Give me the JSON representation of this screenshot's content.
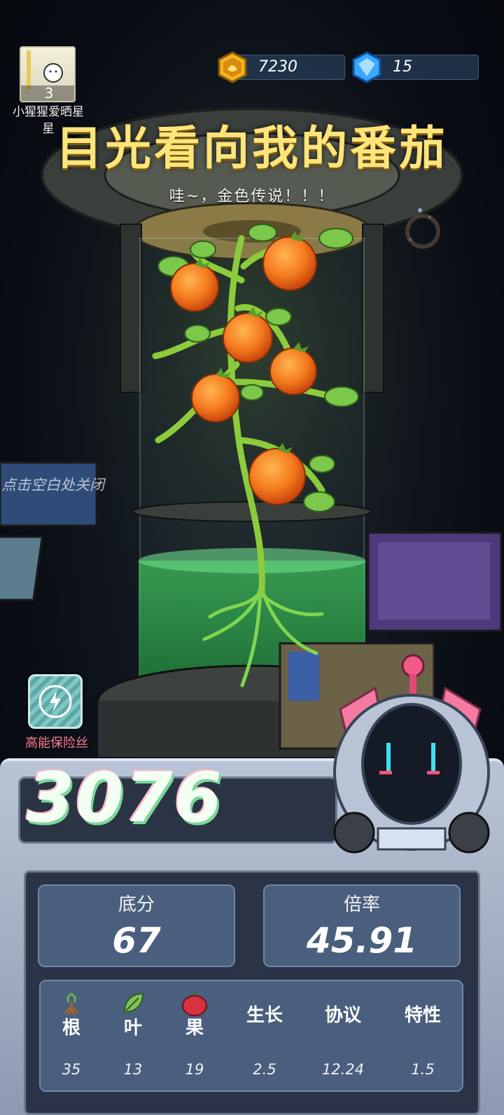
{
  "player": {
    "name": "小猩猩爱晒星星",
    "level": "3"
  },
  "currency": {
    "gold": "7230",
    "gems": "15"
  },
  "title": "目光看向我的番茄",
  "subtitle": "哇~，金色传说！！！",
  "close_hint": "点击空白处关闭",
  "fuse": {
    "label": "高能保险丝"
  },
  "score": {
    "total": "3076"
  },
  "stats": {
    "base": {
      "label": "底分",
      "value": "67"
    },
    "multiplier": {
      "label": "倍率",
      "value": "45.91"
    }
  },
  "attributes": [
    {
      "name": "根",
      "value": "35",
      "icon": "root-icon"
    },
    {
      "name": "叶",
      "value": "13",
      "icon": "leaf-icon"
    },
    {
      "name": "果",
      "value": "19",
      "icon": "fruit-icon"
    },
    {
      "name": "生长",
      "value": "2.5"
    },
    {
      "name": "协议",
      "value": "12.24"
    },
    {
      "name": "特性",
      "value": "1.5"
    }
  ],
  "colors": {
    "title": "#ffe47a",
    "panel": "#2a3446",
    "card": "#4a5f7e",
    "fuse_label": "#ff7f9a"
  }
}
